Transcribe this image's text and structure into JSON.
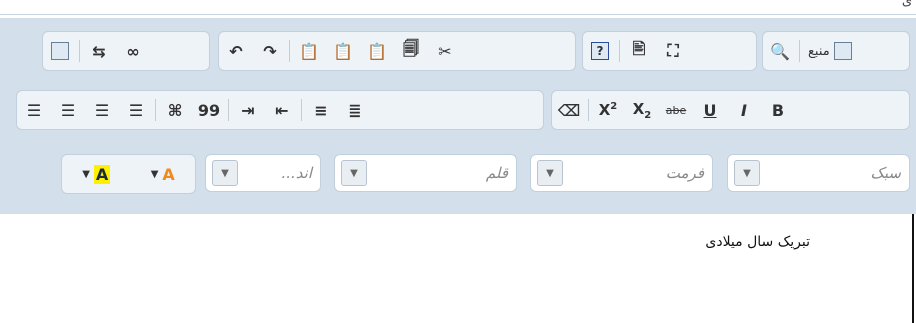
{
  "top_glyph": "ی",
  "toolbar": {
    "source_label": "منبع",
    "bold": "B",
    "italic": "I",
    "underline": "U",
    "strike": "abe",
    "subscript_base": "X",
    "subscript_num": "2",
    "superscript_base": "X",
    "superscript_num": "2",
    "blockquote": "99"
  },
  "combos": {
    "style_label": "سبک",
    "format_label": "فرمت",
    "font_label": "قلم",
    "size_label": "...اند"
  },
  "colors": {
    "text_color_letter": "A",
    "bg_color_letter": "A",
    "text_highlight": "#fff000",
    "bg_highlight": "#f08a1c"
  },
  "content": {
    "text": "تبریک سال میلادی"
  }
}
